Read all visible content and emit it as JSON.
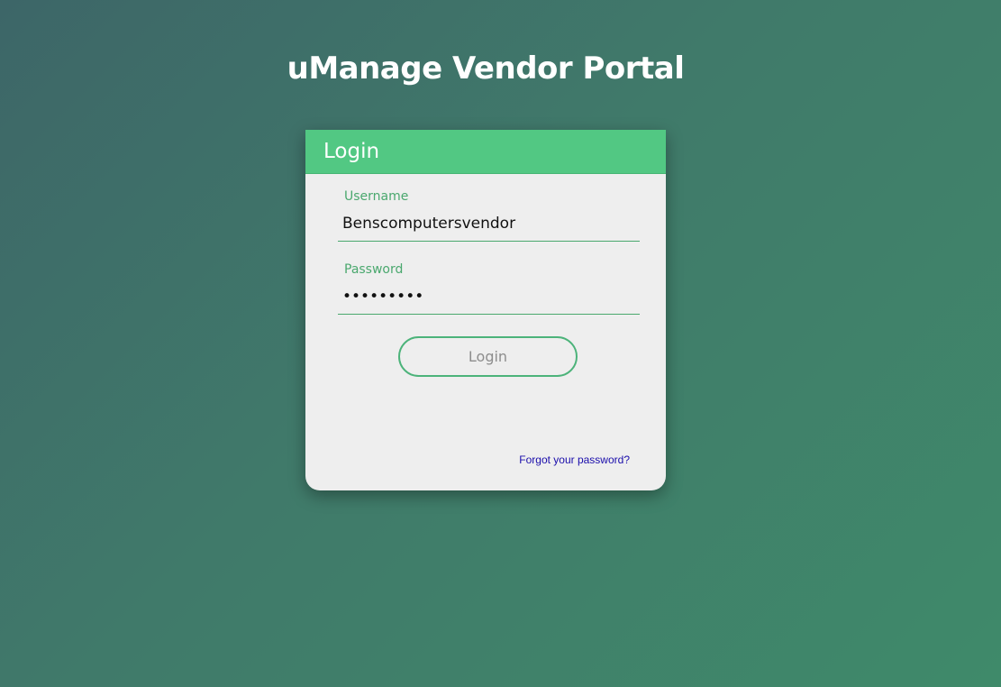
{
  "page": {
    "title": "uManage Vendor Portal"
  },
  "login_card": {
    "header_title": "Login",
    "username": {
      "label": "Username",
      "value": "Benscomputersvendor"
    },
    "password": {
      "label": "Password",
      "value": "•••••••••"
    },
    "login_button_label": "Login",
    "forgot_link_label": "Forgot your password?"
  },
  "colors": {
    "accent_green": "#52c883",
    "label_green": "#4aa86e",
    "link_blue": "#1a0dab",
    "card_background": "#eeeeee"
  }
}
